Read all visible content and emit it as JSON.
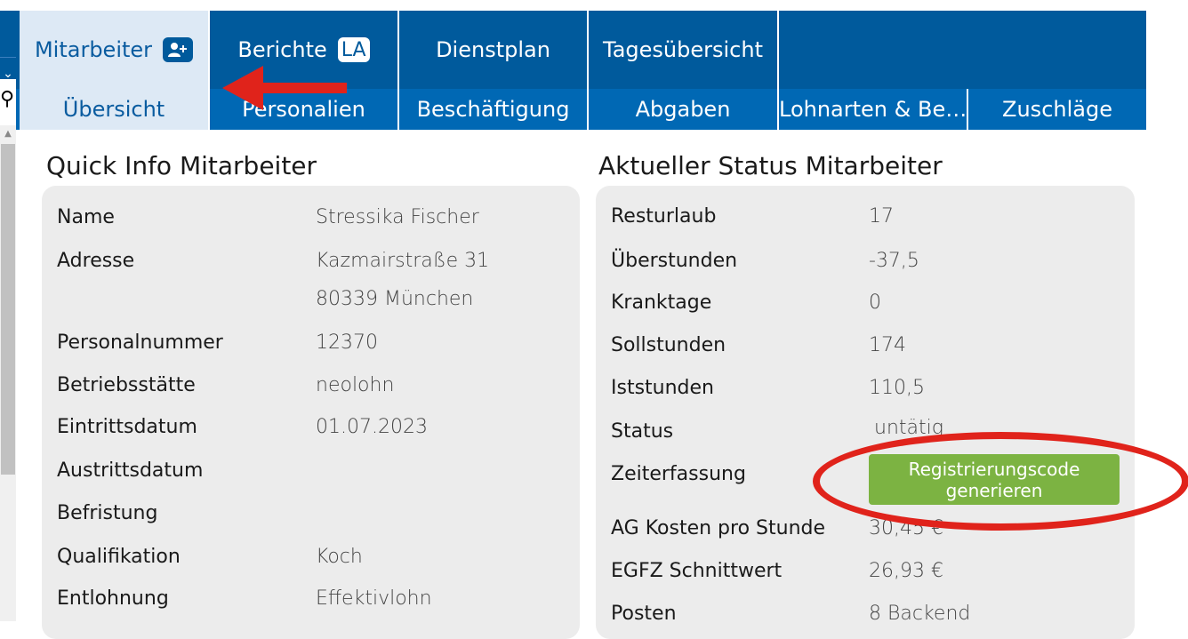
{
  "nav": {
    "tabs": [
      {
        "label": "Mitarbeiter",
        "badge_icon": "add-user-icon"
      },
      {
        "label": "Berichte",
        "badge": "LA"
      },
      {
        "label": "Dienstplan"
      },
      {
        "label": "Tagesübersicht"
      }
    ],
    "subtabs": [
      "Übersicht",
      "Personalien",
      "Beschäftigung",
      "Abgaben",
      "Lohnarten & Be…",
      "Zuschläge"
    ],
    "left_strip": {
      "dropdown_icon": "chevron-down-icon",
      "search_icon": "search-icon"
    }
  },
  "quick_info": {
    "title": "Quick Info Mitarbeiter",
    "rows": [
      {
        "label": "Name",
        "value": "Stressika Fischer"
      },
      {
        "label": "Adresse",
        "value": "Kazmairstraße 31"
      },
      {
        "label": "",
        "value": "80339 München"
      },
      {
        "label": "Personalnummer",
        "value": "12370"
      },
      {
        "label": "Betriebsstätte",
        "value": "neolohn"
      },
      {
        "label": "Eintrittsdatum",
        "value": "01.07.2023"
      },
      {
        "label": "Austrittsdatum",
        "value": ""
      },
      {
        "label": "Befristung",
        "value": ""
      },
      {
        "label": "Qualifikation",
        "value": "Koch"
      },
      {
        "label": "Entlohnung",
        "value": "Effektivlohn"
      }
    ]
  },
  "status": {
    "title": "Aktueller Status Mitarbeiter",
    "rows": [
      {
        "label": "Resturlaub",
        "value": "17"
      },
      {
        "label": "Überstunden",
        "value": "-37,5"
      },
      {
        "label": "Kranktage",
        "value": "0"
      },
      {
        "label": "Sollstunden",
        "value": "174"
      },
      {
        "label": "Iststunden",
        "value": "110,5"
      },
      {
        "label": "Status",
        "value": "untätig"
      },
      {
        "label": "Zeiterfassung",
        "value": ""
      },
      {
        "label": "AG Kosten pro Stunde",
        "value": "30,45 €"
      },
      {
        "label": "EGFZ Schnittwert",
        "value": "26,93 €"
      },
      {
        "label": "Posten",
        "value": "8 Backend"
      }
    ],
    "register_button": "Registrierungscode generieren"
  },
  "colors": {
    "primary": "#005a9c",
    "secondary": "#0068b4",
    "active_tab_bg": "#dde9f5",
    "button_green": "#7cb342",
    "annotation_red": "#e0231b",
    "panel_bg": "#ececec"
  }
}
